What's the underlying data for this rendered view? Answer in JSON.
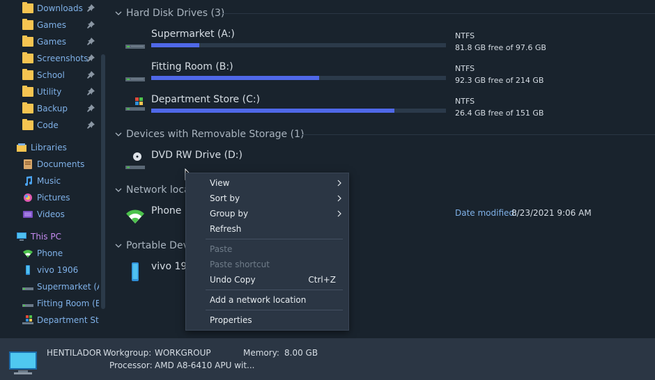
{
  "sidebar": {
    "pinned": [
      {
        "label": "Downloads"
      },
      {
        "label": "Games"
      },
      {
        "label": "Games"
      },
      {
        "label": "Screenshots"
      },
      {
        "label": "School"
      },
      {
        "label": "Utility"
      },
      {
        "label": "Backup"
      },
      {
        "label": "Code"
      }
    ],
    "libraries": {
      "label": "Libraries"
    },
    "library_items": [
      {
        "label": "Documents"
      },
      {
        "label": "Music"
      },
      {
        "label": "Pictures"
      },
      {
        "label": "Videos"
      }
    ],
    "this_pc": {
      "label": "This PC"
    },
    "pc_items": [
      {
        "label": "Phone"
      },
      {
        "label": "vivo 1906"
      },
      {
        "label": "Supermarket (A:"
      },
      {
        "label": "Fitting Room (B:"
      },
      {
        "label": "Department Stor"
      }
    ]
  },
  "groups": {
    "hdd": "Hard Disk Drives (3)",
    "removable": "Devices with Removable Storage (1)",
    "network": "Network loca",
    "portable": "Portable Dev"
  },
  "drives": [
    {
      "name": "Supermarket (A:)",
      "fs": "NTFS",
      "free": "81.8 GB free of 97.6 GB",
      "used_fraction": 0.162
    },
    {
      "name": "Fitting Room (B:)",
      "fs": "NTFS",
      "free": "92.3 GB free of 214 GB",
      "used_fraction": 0.569
    },
    {
      "name": "Department Store (C:)",
      "fs": "NTFS",
      "free": "26.4 GB free of 151 GB",
      "used_fraction": 0.825
    }
  ],
  "dvd": {
    "name": "DVD RW Drive (D:)"
  },
  "network_item": {
    "name": "Phone",
    "date_label": "Date modified:",
    "date_value": "8/23/2021 9:06 AM"
  },
  "portable_item": {
    "name": "vivo 190"
  },
  "context_menu": {
    "view": "View",
    "sort_by": "Sort by",
    "group_by": "Group by",
    "refresh": "Refresh",
    "paste": "Paste",
    "paste_shortcut": "Paste shortcut",
    "undo_copy": "Undo Copy",
    "undo_shortcut": "Ctrl+Z",
    "add_network": "Add a network location",
    "properties": "Properties"
  },
  "details": {
    "pc_name": "HENTILADOR",
    "workgroup_label": "Workgroup:",
    "workgroup_value": "WORKGROUP",
    "memory_label": "Memory:",
    "memory_value": "8.00 GB",
    "processor_label": "Processor:",
    "processor_value": "AMD A8-6410 APU wit..."
  },
  "colors": {
    "accent_bar": "#4f68e8",
    "folder": "#f6c451",
    "nav_text": "#7fb1e8",
    "this_pc_text": "#c58bf0"
  }
}
